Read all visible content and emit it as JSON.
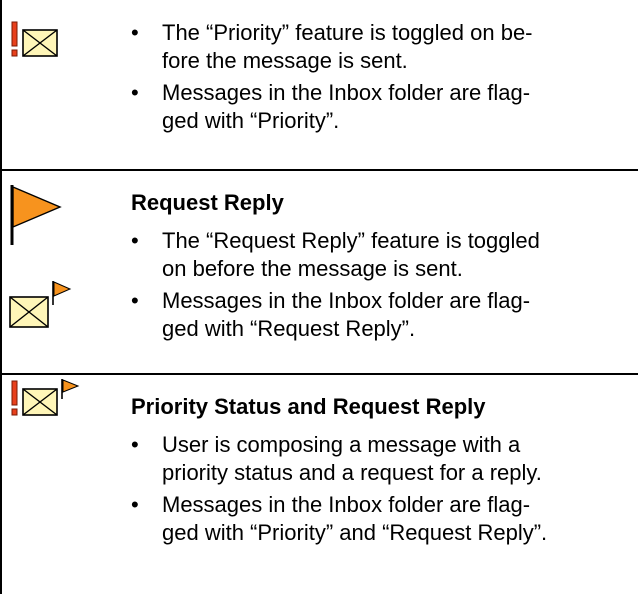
{
  "colors": {
    "envelope_fill": "#FFF6B8",
    "exclamation": "#E8401C",
    "flag_orange": "#F7931E",
    "rule": "#000000"
  },
  "sections": [
    {
      "heading": "",
      "icons": [
        "priority-exclamation-icon",
        "envelope-icon"
      ],
      "bullets": [
        [
          "The “Priority” feature is toggled on be-",
          "fore the message is sent."
        ],
        [
          "Messages in the Inbox folder are flag-",
          "ged with “Priority”."
        ]
      ]
    },
    {
      "heading": "Request Reply",
      "icons": [
        "flag-icon",
        "envelope-with-flag-icon"
      ],
      "bullets": [
        [
          "The “Request Reply” feature is toggled",
          "on before the message is sent."
        ],
        [
          "Messages in the Inbox folder are flag-",
          "ged with “Request Reply”."
        ]
      ]
    },
    {
      "heading": "Priority Status and Request Reply",
      "icons": [
        "priority-exclamation-icon",
        "envelope-with-flag-icon"
      ],
      "bullets": [
        [
          "User is composing a message with a",
          "priority status and a request for a reply."
        ],
        [
          "Messages in the Inbox folder are flag-",
          "ged with “Priority” and “Request Reply”."
        ]
      ]
    }
  ],
  "bullet_glyph": "•"
}
